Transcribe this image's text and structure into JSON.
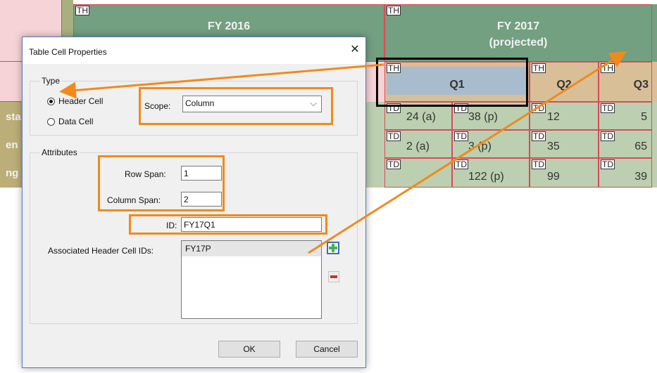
{
  "table": {
    "fy2016": "FY 2016",
    "fy2017_line1": "FY 2017",
    "fy2017_line2": "(projected)",
    "q1": "Q1",
    "q2": "Q2",
    "q3": "Q3",
    "th_tag": "TH",
    "td_tag": "TD",
    "row_label_1": "sta",
    "row_label_2": "en",
    "row_label_3": "ng",
    "rows": [
      [
        "24 (a)",
        "38 (p)",
        "12",
        "5"
      ],
      [
        "2 (a)",
        "3 (p)",
        "35",
        "65"
      ],
      [
        "",
        "122 (p)",
        "99",
        "39"
      ]
    ]
  },
  "dialog": {
    "title": "Table Cell Properties",
    "close": "✕",
    "type_group": "Type",
    "header_cell": "Header Cell",
    "data_cell": "Data Cell",
    "scope_label": "Scope:",
    "scope_value": "Column",
    "dropdown_glyph": "⌵",
    "attributes_group": "Attributes",
    "row_span_label": "Row Span:",
    "row_span_value": "1",
    "col_span_label": "Column Span:",
    "col_span_value": "2",
    "id_label": "ID:",
    "id_value": "FY17Q1",
    "assoc_label": "Associated Header Cell IDs:",
    "assoc_items": [
      "FY17P"
    ],
    "ok": "OK",
    "cancel": "Cancel"
  },
  "colors": {
    "header_green": "#72a080",
    "q_tan": "#d8bf98",
    "cell_green": "#bcceb0",
    "pink": "#f6d3d6",
    "annotation_orange": "#f08a1c",
    "focus_black": "#000000",
    "add_icon_green": "#4caf50",
    "remove_icon_red": "#c0392b"
  }
}
